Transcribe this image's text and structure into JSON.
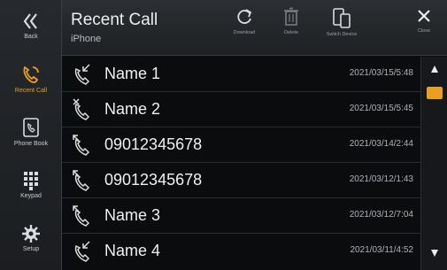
{
  "accent_color": "#e8a020",
  "sidebar": {
    "back_label": "Back",
    "items": [
      {
        "label": "Recent Call",
        "icon": "recent-call-icon",
        "active": true
      },
      {
        "label": "Phone Book",
        "icon": "phone-book-icon",
        "active": false
      },
      {
        "label": "Keypad",
        "icon": "keypad-icon",
        "active": false
      },
      {
        "label": "Setup",
        "icon": "gear-icon",
        "active": false
      }
    ]
  },
  "header": {
    "title": "Recent Call",
    "subtitle": "iPhone",
    "tools": [
      {
        "label": "Download",
        "icon": "refresh-icon",
        "enabled": true
      },
      {
        "label": "Delete",
        "icon": "trash-icon",
        "enabled": false
      },
      {
        "label": "Switch Device",
        "icon": "switch-device-icon",
        "enabled": true
      },
      {
        "label": "Close",
        "icon": "close-icon",
        "enabled": true
      }
    ]
  },
  "calls": [
    {
      "name": "Name 1",
      "time": "2021/03/15/5:48",
      "type": "incoming"
    },
    {
      "name": "Name 2",
      "time": "2021/03/15/5:45",
      "type": "missed"
    },
    {
      "name": "09012345678",
      "time": "2021/03/14/2:44",
      "type": "outgoing"
    },
    {
      "name": "09012345678",
      "time": "2021/03/12/1:43",
      "type": "outgoing"
    },
    {
      "name": "Name 3",
      "time": "2021/03/12/7:04",
      "type": "outgoing"
    },
    {
      "name": "Name 4",
      "time": "2021/03/11/4:52",
      "type": "incoming"
    }
  ]
}
